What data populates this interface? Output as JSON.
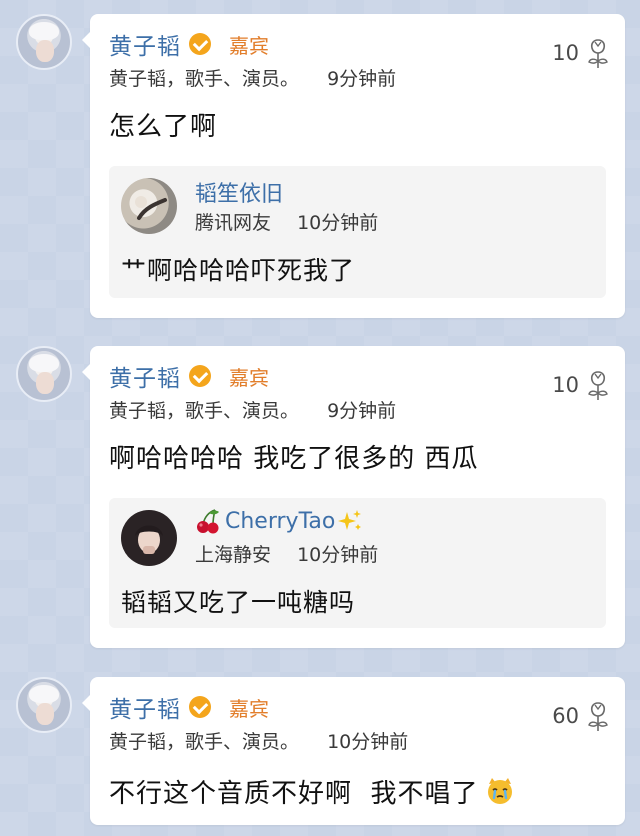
{
  "posts": [
    {
      "author": "黄子韬",
      "badge": "嘉宾",
      "bio": "黄子韬，歌手、演员。",
      "time": "9分钟前",
      "likes": "10",
      "text": "怎么了啊",
      "quote": {
        "name": "韬笙依旧",
        "location": "腾讯网友",
        "time": "10分钟前",
        "text": "艹啊哈哈哈吓死我了"
      }
    },
    {
      "author": "黄子韬",
      "badge": "嘉宾",
      "bio": "黄子韬，歌手、演员。",
      "time": "9分钟前",
      "likes": "10",
      "text": "啊哈哈哈哈 我吃了很多的 西瓜",
      "quote": {
        "name": "CherryTao",
        "location": "上海静安",
        "time": "10分钟前",
        "text": "韬韬又吃了一吨糖吗"
      }
    },
    {
      "author": "黄子韬",
      "badge": "嘉宾",
      "bio": "黄子韬，歌手、演员。",
      "time": "10分钟前",
      "likes": "60",
      "text": "不行这个音质不好啊  我不唱了"
    }
  ],
  "icons": {
    "like": "rose-icon",
    "verified": "verified-badge-icon",
    "emoji": "crying-cat-emoji"
  },
  "colors": {
    "author": "#3d6fa8",
    "badge": "#e27e2b",
    "verified": "#f4a51c",
    "background": "#c9d4e6"
  }
}
